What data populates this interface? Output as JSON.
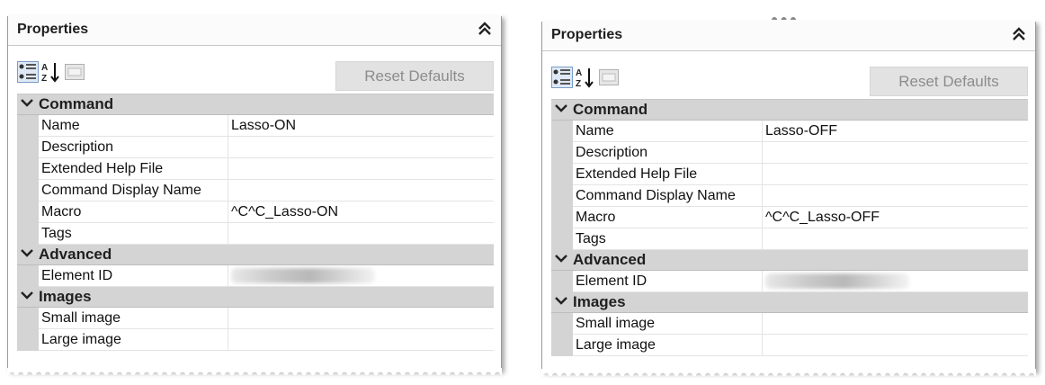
{
  "panels": [
    {
      "header": {
        "title": "Properties",
        "collapse_icon": "double-chevron-up-icon"
      },
      "toolbar": {
        "icons": [
          "categorized-icon",
          "sort-alphabetical-icon",
          "property-pages-icon"
        ],
        "reset_label": "Reset Defaults"
      },
      "categories": [
        {
          "name": "Command",
          "rows": [
            {
              "key": "Name",
              "value": "Lasso-ON"
            },
            {
              "key": "Description",
              "value": ""
            },
            {
              "key": "Extended Help File",
              "value": ""
            },
            {
              "key": "Command Display Name",
              "value": ""
            },
            {
              "key": "Macro",
              "value": "^C^C_Lasso-ON"
            },
            {
              "key": "Tags",
              "value": ""
            }
          ]
        },
        {
          "name": "Advanced",
          "rows": [
            {
              "key": "Element ID",
              "value": ""
            }
          ]
        },
        {
          "name": "Images",
          "rows": [
            {
              "key": "Small image",
              "value": ""
            },
            {
              "key": "Large image",
              "value": ""
            }
          ]
        }
      ]
    },
    {
      "header": {
        "title": "Properties",
        "collapse_icon": "double-chevron-up-icon"
      },
      "toolbar": {
        "icons": [
          "categorized-icon",
          "sort-alphabetical-icon",
          "property-pages-icon"
        ],
        "reset_label": "Reset Defaults"
      },
      "categories": [
        {
          "name": "Command",
          "rows": [
            {
              "key": "Name",
              "value": "Lasso-OFF"
            },
            {
              "key": "Description",
              "value": ""
            },
            {
              "key": "Extended Help File",
              "value": ""
            },
            {
              "key": "Command Display Name",
              "value": ""
            },
            {
              "key": "Macro",
              "value": "^C^C_Lasso-OFF"
            },
            {
              "key": "Tags",
              "value": ""
            }
          ]
        },
        {
          "name": "Advanced",
          "rows": [
            {
              "key": "Element ID",
              "value": ""
            }
          ]
        },
        {
          "name": "Images",
          "rows": [
            {
              "key": "Small image",
              "value": ""
            },
            {
              "key": "Large image",
              "value": ""
            }
          ]
        }
      ]
    }
  ]
}
